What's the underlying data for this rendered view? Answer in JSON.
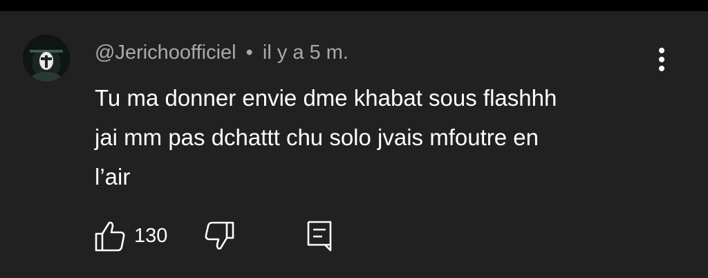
{
  "comment": {
    "author": "@Jerichoofficiel",
    "separator": "•",
    "time": "il y a 5 m.",
    "text_lines": [
      "Tu ma donner envie dme khabat sous flashhh",
      "jai mm pas dchattt chu solo jvais mfoutre en",
      "l’air"
    ],
    "like_count": "130"
  },
  "icons": {
    "like": "thumbs-up-icon",
    "dislike": "thumbs-down-icon",
    "reply": "comment-reply-icon",
    "menu": "more-vert-icon"
  },
  "colors": {
    "background": "#212121",
    "meta_text": "#aaaaaa",
    "text": "#ffffff"
  }
}
